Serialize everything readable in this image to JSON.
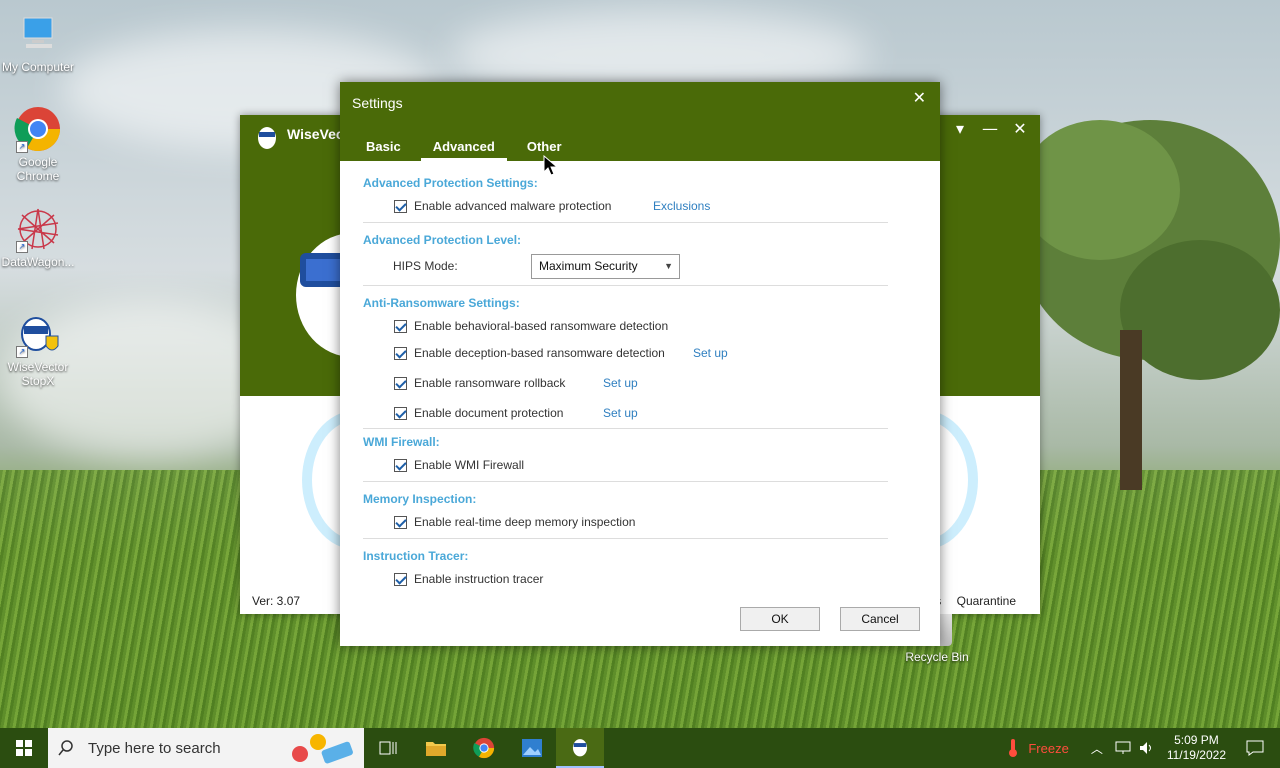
{
  "desktop": {
    "icons": [
      {
        "label": "My Computer"
      },
      {
        "label": "Google Chrome"
      },
      {
        "label": "DataWagon..."
      },
      {
        "label": "WiseVector StopX"
      }
    ],
    "recycle_bin": "Recycle Bin"
  },
  "main_window": {
    "title": "WiseVec",
    "version": "Ver: 3.07",
    "partial_left": "s",
    "quarantine": "Quarantine"
  },
  "dialog": {
    "title": "Settings",
    "tabs": [
      {
        "label": "Basic"
      },
      {
        "label": "Advanced"
      },
      {
        "label": "Other"
      }
    ],
    "sections": {
      "adv_prot": {
        "title": "Advanced Protection Settings:",
        "item": "Enable advanced malware protection",
        "link": "Exclusions"
      },
      "adv_level": {
        "title": "Advanced Protection Level:",
        "hips_label": "HIPS Mode:",
        "hips_value": "Maximum Security"
      },
      "ransom": {
        "title": "Anti-Ransomware Settings:",
        "items": [
          {
            "label": "Enable behavioral-based ransomware detection"
          },
          {
            "label": "Enable deception-based ransomware detection",
            "link": "Set up"
          },
          {
            "label": "Enable ransomware rollback",
            "link": "Set up"
          },
          {
            "label": "Enable document protection",
            "link": "Set up"
          }
        ]
      },
      "wmi": {
        "title": "WMI Firewall:",
        "item": "Enable WMI Firewall"
      },
      "memory": {
        "title": "Memory Inspection:",
        "item": "Enable real-time deep memory inspection"
      },
      "tracer": {
        "title": "Instruction Tracer:",
        "item": "Enable instruction tracer"
      }
    },
    "ok": "OK",
    "cancel": "Cancel"
  },
  "taskbar": {
    "search_placeholder": "Type here to search",
    "freeze": "Freeze",
    "time": "5:09 PM",
    "date": "11/19/2022"
  }
}
